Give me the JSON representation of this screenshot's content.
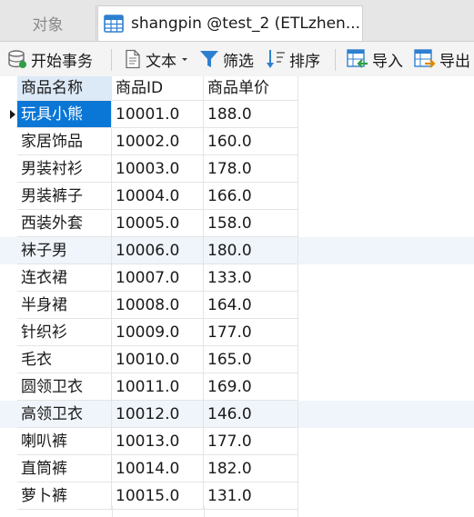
{
  "tabs": {
    "objects_label": "对象",
    "active_label": "shangpin @test_2 (ETLzhen..."
  },
  "toolbar": {
    "begin_transaction": "开始事务",
    "text": "文本",
    "filter": "筛选",
    "sort": "排序",
    "import": "导入",
    "export": "导出"
  },
  "grid": {
    "columns": [
      "商品名称",
      "商品ID",
      "商品单价"
    ],
    "rows": [
      [
        "玩具小熊",
        "10001.0",
        "188.0"
      ],
      [
        "家居饰品",
        "10002.0",
        "160.0"
      ],
      [
        "男装衬衫",
        "10003.0",
        "178.0"
      ],
      [
        "男装裤子",
        "10004.0",
        "166.0"
      ],
      [
        "西装外套",
        "10005.0",
        "158.0"
      ],
      [
        "袜子男",
        "10006.0",
        "180.0"
      ],
      [
        "连衣裙",
        "10007.0",
        "133.0"
      ],
      [
        "半身裙",
        "10008.0",
        "164.0"
      ],
      [
        "针织衫",
        "10009.0",
        "177.0"
      ],
      [
        "毛衣",
        "10010.0",
        "165.0"
      ],
      [
        "圆领卫衣",
        "10011.0",
        "169.0"
      ],
      [
        "高领卫衣",
        "10012.0",
        "146.0"
      ],
      [
        "喇叭裤",
        "10013.0",
        "177.0"
      ],
      [
        "直筒裤",
        "10014.0",
        "182.0"
      ],
      [
        "萝卜裤",
        "10015.0",
        "131.0"
      ]
    ]
  },
  "colors": {
    "selection": "#0a76d6",
    "header_highlight": "#dce9f7",
    "alt_row": "#f0f5fb",
    "icon_blue": "#2f7fd1"
  }
}
